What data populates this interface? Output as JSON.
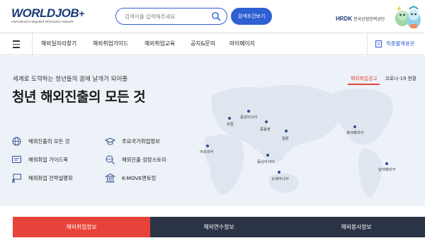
{
  "header": {
    "logo_main": "WORLDJOB",
    "logo_plus": "+",
    "logo_sub": "International Integrated Information Network",
    "search_placeholder": "검색어를 입력해주세요",
    "detail_search_label": "검색조건보기",
    "org_logo": "HRDK",
    "org_name": "한국산업인력공단",
    "colors": {
      "brand": "#1b3a7a",
      "accent": "#2f5fd3"
    }
  },
  "nav": {
    "items": [
      "해외일자리찾기",
      "해외취업가이드",
      "해외취업교육",
      "공지&문의",
      "마이페이지"
    ],
    "right_link": "직종별채용관"
  },
  "hero": {
    "subtitle": "세계로 도약하는 청년들의 꿈에 날개가 되어줄",
    "title": "청년 해외진출의 모든 것",
    "tabs": [
      {
        "label": "해외취업공고",
        "active": true
      },
      {
        "label": "코로나-19 현황",
        "active": false
      }
    ],
    "quick_links": [
      {
        "label": "해외진출의 모든 것",
        "icon": "globe-icon"
      },
      {
        "label": "주요국가취업정보",
        "icon": "graduation-cap-icon"
      },
      {
        "label": "해외취업 가이드북",
        "icon": "guidebook-icon"
      },
      {
        "label": "해외진출 성장스토리",
        "icon": "globe-search-icon"
      },
      {
        "label": "해외취업 전략설명회",
        "icon": "presentation-icon"
      },
      {
        "label": "K-MOVE멘토링",
        "icon": "institution-icon"
      }
    ],
    "map_regions": [
      "유럽",
      "중앙아시아",
      "중동권",
      "일본",
      "북아메리카",
      "아프리카",
      "동남아시아",
      "남아메리카",
      "오세아니아"
    ],
    "active_color": "#e2443a"
  },
  "bottom_tabs": [
    {
      "label": "해외취업정보",
      "color": "#e8433a"
    },
    {
      "label": "해외연수정보",
      "color": "#2b3447"
    },
    {
      "label": "해외봉사정보",
      "color": "#2b3447"
    }
  ]
}
